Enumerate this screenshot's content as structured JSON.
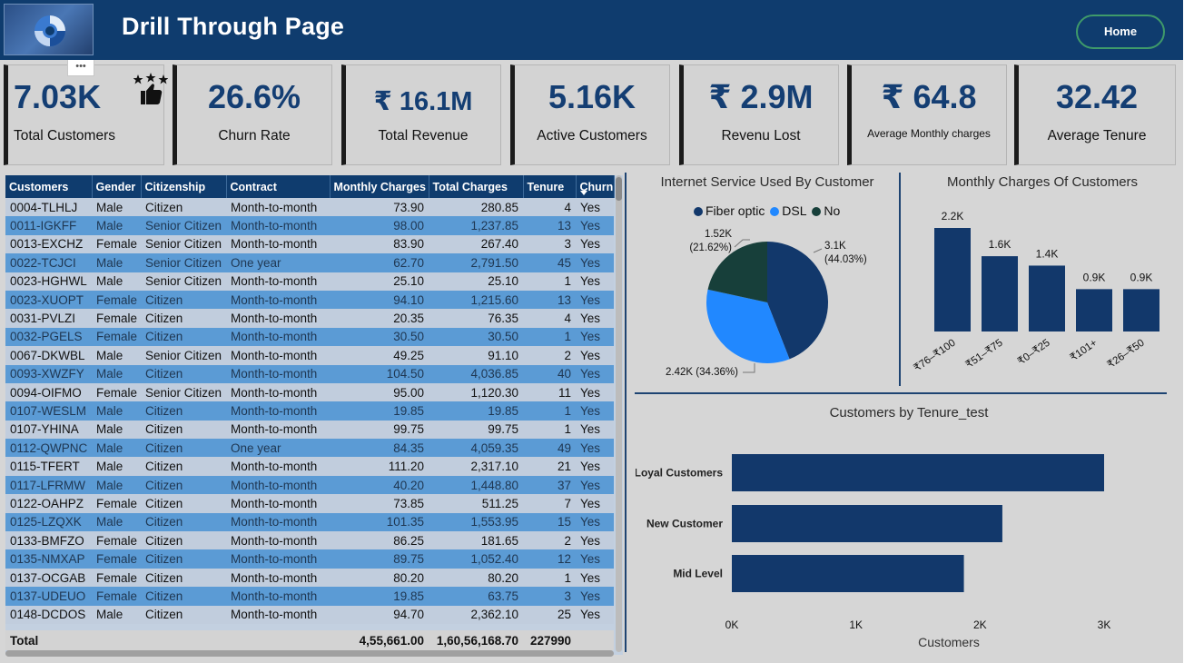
{
  "header": {
    "title": "Drill Through Page",
    "home_label": "Home",
    "more_options": "•••"
  },
  "kpis": [
    {
      "value": "7.03K",
      "label": "Total Customers"
    },
    {
      "value": "26.6%",
      "label": "Churn Rate"
    },
    {
      "value": "₹ 16.1M",
      "label": "Total Revenue"
    },
    {
      "value": "5.16K",
      "label": "Active Customers"
    },
    {
      "value": "₹ 2.9M",
      "label": "Revenu Lost"
    },
    {
      "value": "₹ 64.8",
      "label": "Average Monthly charges"
    },
    {
      "value": "32.42",
      "label": "Average Tenure"
    }
  ],
  "table": {
    "columns": [
      "Customers",
      "Gender",
      "Citizenship",
      "Contract",
      "Monthly Charges",
      "Total Charges",
      "Tenure",
      "Churn"
    ],
    "rows": [
      [
        "0004-TLHLJ",
        "Male",
        "Citizen",
        "Month-to-month",
        "73.90",
        "280.85",
        "4",
        "Yes"
      ],
      [
        "0011-IGKFF",
        "Male",
        "Senior Citizen",
        "Month-to-month",
        "98.00",
        "1,237.85",
        "13",
        "Yes"
      ],
      [
        "0013-EXCHZ",
        "Female",
        "Senior Citizen",
        "Month-to-month",
        "83.90",
        "267.40",
        "3",
        "Yes"
      ],
      [
        "0022-TCJCI",
        "Male",
        "Senior Citizen",
        "One year",
        "62.70",
        "2,791.50",
        "45",
        "Yes"
      ],
      [
        "0023-HGHWL",
        "Male",
        "Senior Citizen",
        "Month-to-month",
        "25.10",
        "25.10",
        "1",
        "Yes"
      ],
      [
        "0023-XUOPT",
        "Female",
        "Citizen",
        "Month-to-month",
        "94.10",
        "1,215.60",
        "13",
        "Yes"
      ],
      [
        "0031-PVLZI",
        "Female",
        "Citizen",
        "Month-to-month",
        "20.35",
        "76.35",
        "4",
        "Yes"
      ],
      [
        "0032-PGELS",
        "Female",
        "Citizen",
        "Month-to-month",
        "30.50",
        "30.50",
        "1",
        "Yes"
      ],
      [
        "0067-DKWBL",
        "Male",
        "Senior Citizen",
        "Month-to-month",
        "49.25",
        "91.10",
        "2",
        "Yes"
      ],
      [
        "0093-XWZFY",
        "Male",
        "Citizen",
        "Month-to-month",
        "104.50",
        "4,036.85",
        "40",
        "Yes"
      ],
      [
        "0094-OIFMO",
        "Female",
        "Senior Citizen",
        "Month-to-month",
        "95.00",
        "1,120.30",
        "11",
        "Yes"
      ],
      [
        "0107-WESLM",
        "Male",
        "Citizen",
        "Month-to-month",
        "19.85",
        "19.85",
        "1",
        "Yes"
      ],
      [
        "0107-YHINA",
        "Male",
        "Citizen",
        "Month-to-month",
        "99.75",
        "99.75",
        "1",
        "Yes"
      ],
      [
        "0112-QWPNC",
        "Male",
        "Citizen",
        "One year",
        "84.35",
        "4,059.35",
        "49",
        "Yes"
      ],
      [
        "0115-TFERT",
        "Male",
        "Citizen",
        "Month-to-month",
        "111.20",
        "2,317.10",
        "21",
        "Yes"
      ],
      [
        "0117-LFRMW",
        "Male",
        "Citizen",
        "Month-to-month",
        "40.20",
        "1,448.80",
        "37",
        "Yes"
      ],
      [
        "0122-OAHPZ",
        "Female",
        "Citizen",
        "Month-to-month",
        "73.85",
        "511.25",
        "7",
        "Yes"
      ],
      [
        "0125-LZQXK",
        "Male",
        "Citizen",
        "Month-to-month",
        "101.35",
        "1,553.95",
        "15",
        "Yes"
      ],
      [
        "0133-BMFZO",
        "Female",
        "Citizen",
        "Month-to-month",
        "86.25",
        "181.65",
        "2",
        "Yes"
      ],
      [
        "0135-NMXAP",
        "Female",
        "Citizen",
        "Month-to-month",
        "89.75",
        "1,052.40",
        "12",
        "Yes"
      ],
      [
        "0137-OCGAB",
        "Female",
        "Citizen",
        "Month-to-month",
        "80.20",
        "80.20",
        "1",
        "Yes"
      ],
      [
        "0137-UDEUO",
        "Female",
        "Citizen",
        "Month-to-month",
        "19.85",
        "63.75",
        "3",
        "Yes"
      ],
      [
        "0148-DCDOS",
        "Male",
        "Citizen",
        "Month-to-month",
        "94.70",
        "2,362.10",
        "25",
        "Yes"
      ]
    ],
    "total": {
      "label": "Total",
      "monthly": "4,55,661.00",
      "total_charges": "1,60,56,168.70",
      "tenure": "227990"
    }
  },
  "colors": {
    "header": "#0f3c6e",
    "fiber": "#12386b",
    "dsl": "#2188ff",
    "no": "#173f3a",
    "bar": "#12386b"
  },
  "chart_data": [
    {
      "type": "pie",
      "title": "Internet Service Used By Customer",
      "legend_position": "top",
      "slices": [
        {
          "name": "Fiber optic",
          "value": 3.1,
          "label": "3.1K",
          "pct": "(44.03%)"
        },
        {
          "name": "DSL",
          "value": 2.42,
          "label": "2.42K (34.36%)",
          "pct": ""
        },
        {
          "name": "No",
          "value": 1.52,
          "label": "1.52K",
          "pct": "(21.62%)"
        }
      ]
    },
    {
      "type": "bar",
      "title": "Monthly Charges Of Customers",
      "categories": [
        "₹76–₹100",
        "₹51–₹75",
        "₹0–₹25",
        "₹101+",
        "₹26–₹50"
      ],
      "values": [
        2.2,
        1.6,
        1.4,
        0.9,
        0.9
      ],
      "labels": [
        "2.2K",
        "1.6K",
        "1.4K",
        "0.9K",
        "0.9K"
      ]
    },
    {
      "type": "bar",
      "orientation": "horizontal",
      "title": "Customers by Tenure_test",
      "categories": [
        "Loyal Customers",
        "New Customer",
        "Mid Level"
      ],
      "values": [
        3000,
        2180,
        1870
      ],
      "xlabel": "Customers",
      "xticks": [
        "0K",
        "1K",
        "2K",
        "3K"
      ],
      "xlim": [
        0,
        3000
      ]
    }
  ]
}
